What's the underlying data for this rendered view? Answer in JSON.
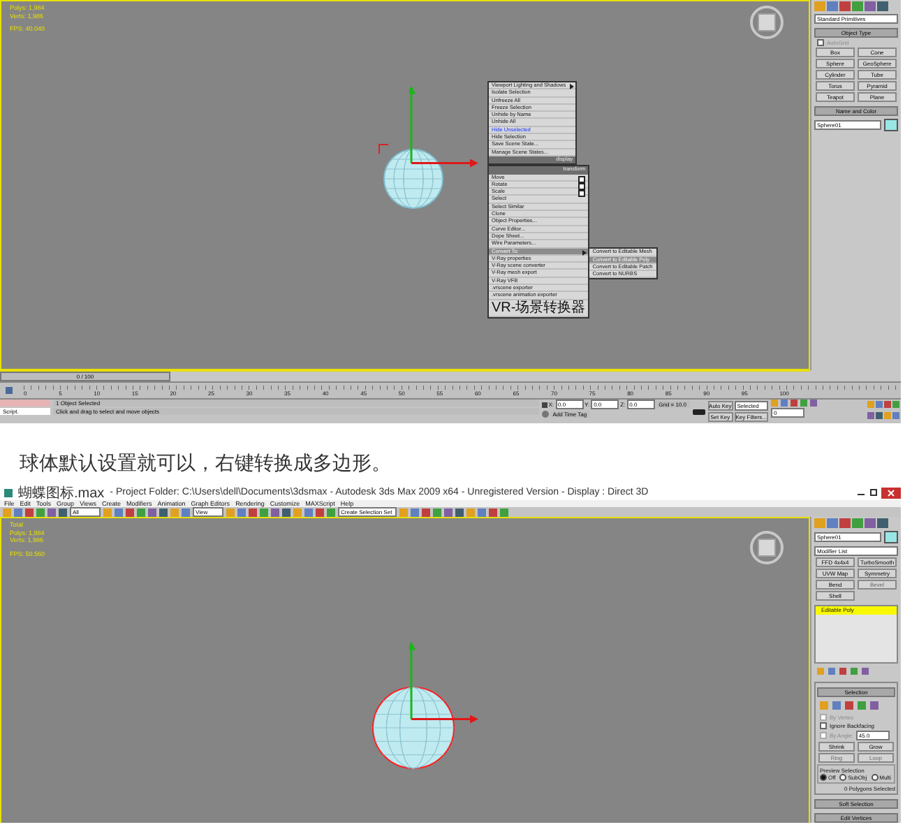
{
  "screenshot_1": {
    "viewport": {
      "stats": [
        "Polys: 1,984",
        "Verts: 1,986",
        "FPS: 40.040"
      ]
    },
    "quad_menu": {
      "items": [
        {
          "kind": "item",
          "label": "Viewport Lighting and Shadows",
          "arrow": true,
          "options": false,
          "selected": false
        },
        {
          "kind": "item",
          "label": "Isolate Selection",
          "arrow": false,
          "options": false,
          "selected": false
        },
        {
          "kind": "item",
          "label": "Unfreeze All",
          "arrow": false,
          "options": false,
          "selected": false
        },
        {
          "kind": "item",
          "label": "Freeze Selection",
          "arrow": false,
          "options": false,
          "selected": false
        },
        {
          "kind": "item",
          "label": "Unhide by Name",
          "arrow": false,
          "options": false,
          "selected": false
        },
        {
          "kind": "item",
          "label": "Unhide All",
          "arrow": false,
          "options": false,
          "selected": false
        },
        {
          "kind": "link",
          "label": "Hide Unselected",
          "arrow": false,
          "options": false,
          "selected": false
        },
        {
          "kind": "item",
          "label": "Hide Selection",
          "arrow": false,
          "options": false,
          "selected": false
        },
        {
          "kind": "item",
          "label": "Save Scene State...",
          "arrow": false,
          "options": false,
          "selected": false
        },
        {
          "kind": "item",
          "label": "Manage Scene States...",
          "arrow": false,
          "options": false,
          "selected": false
        },
        {
          "kind": "header",
          "label": "display",
          "arrow": false,
          "options": false,
          "selected": false
        },
        {
          "kind": "header",
          "label": "transform",
          "arrow": false,
          "options": false,
          "selected": false
        },
        {
          "kind": "item",
          "label": "Move",
          "arrow": false,
          "options": true,
          "selected": false
        },
        {
          "kind": "item",
          "label": "Rotate",
          "arrow": false,
          "options": true,
          "selected": false
        },
        {
          "kind": "item",
          "label": "Scale",
          "arrow": false,
          "options": true,
          "selected": false
        },
        {
          "kind": "item",
          "label": "Select",
          "arrow": false,
          "options": false,
          "selected": false
        },
        {
          "kind": "item",
          "label": "Select Similar",
          "arrow": false,
          "options": false,
          "selected": false
        },
        {
          "kind": "item",
          "label": "Clone",
          "arrow": false,
          "options": false,
          "selected": false
        },
        {
          "kind": "item",
          "label": "Object Properties...",
          "arrow": false,
          "options": false,
          "selected": false
        },
        {
          "kind": "item",
          "label": "Curve Editor...",
          "arrow": false,
          "options": false,
          "selected": false
        },
        {
          "kind": "item",
          "label": "Dope Sheet...",
          "arrow": false,
          "options": false,
          "selected": false
        },
        {
          "kind": "item",
          "label": "Wire Parameters...",
          "arrow": false,
          "options": false,
          "selected": false
        },
        {
          "kind": "item",
          "label": "Convert To:",
          "arrow": true,
          "options": false,
          "selected": true
        },
        {
          "kind": "item",
          "label": "V-Ray properties",
          "arrow": false,
          "options": false,
          "selected": false
        },
        {
          "kind": "item",
          "label": "V-Ray scene converter",
          "arrow": false,
          "options": false,
          "selected": false
        },
        {
          "kind": "item",
          "label": "V-Ray mesh export",
          "arrow": false,
          "options": false,
          "selected": false
        },
        {
          "kind": "item",
          "label": "V-Ray VFB",
          "arrow": false,
          "options": false,
          "selected": false
        },
        {
          "kind": "item",
          "label": ".vrscene exporter",
          "arrow": false,
          "options": false,
          "selected": false
        },
        {
          "kind": "item",
          "label": ".vrscene animation exporter",
          "arrow": false,
          "options": false,
          "selected": false
        },
        {
          "kind": "item",
          "label": "VR-场景转换器",
          "arrow": false,
          "options": false,
          "selected": false
        }
      ],
      "submenu": [
        {
          "label": "Convert to Editable Mesh",
          "selected": false
        },
        {
          "label": "Convert to Editable Poly",
          "selected": true
        },
        {
          "label": "Convert to Editable Patch",
          "selected": false
        },
        {
          "label": "Convert to NURBS",
          "selected": false
        }
      ]
    },
    "command_panel": {
      "dropdown": "Standard Primitives",
      "object_type": "Object Type",
      "autogrid": {
        "label": "AutoGrid",
        "checked": false
      },
      "buttons": [
        "Box",
        "Cone",
        "Sphere",
        "GeoSphere",
        "Cylinder",
        "Tube",
        "Torus",
        "Pyramid",
        "Teapot",
        "Plane"
      ],
      "name_and_color": "Name and Color",
      "name": "Sphere01",
      "color": "#99e6e6"
    },
    "timeline": {
      "position": "0 / 100",
      "ticks": [
        "0",
        "5",
        "10",
        "15",
        "20",
        "25",
        "30",
        "35",
        "40",
        "45",
        "50",
        "55",
        "60",
        "65",
        "70",
        "75",
        "80",
        "85",
        "90",
        "95",
        "100"
      ]
    },
    "status": {
      "script": "Script.",
      "selection": "1 Object Selected",
      "prompt": "Click and drag to select and move objects",
      "coords": [
        {
          "label": "X:",
          "value": "0.0"
        },
        {
          "label": "Y:",
          "value": "0.0"
        },
        {
          "label": "Z:",
          "value": "0.0"
        }
      ],
      "grid": "Grid = 10.0",
      "time_tag": "Add Time Tag",
      "auto_key": "Auto Key",
      "key_mode": "Selected",
      "set_key": "Set Key",
      "key_filters": "Key Filters...",
      "frame": "0"
    }
  },
  "caption": "球体默认设置就可以，右键转换成多边形。",
  "screenshot_2": {
    "title_file": "蝴蝶图标.max",
    "title_rest": "- Project Folder: C:\\Users\\dell\\Documents\\3dsmax    - Autodesk 3ds Max  2009 x64  - Unregistered Version    - Display : Direct 3D",
    "menu": [
      "File",
      "Edit",
      "Tools",
      "Group",
      "Views",
      "Create",
      "Modifiers",
      "Animation",
      "Graph Editors",
      "Rendering",
      "Customize",
      "MAXScript",
      "Help"
    ],
    "toolbar": {
      "filter": "All",
      "coord": "View",
      "selection_set": "Create Selection Set"
    },
    "viewport": {
      "stats": [
        "Total",
        "Polys: 1,984",
        "Verts: 1,986",
        "FPS: 50.560"
      ]
    },
    "command_panel": {
      "name": "Sphere01",
      "color": "#99e6e6",
      "modifier_list": "Modifier List",
      "buttons": [
        {
          "label": "FFD 4x4x4",
          "disabled": false
        },
        {
          "label": "TurboSmooth",
          "disabled": false
        },
        {
          "label": "UVW Map",
          "disabled": false
        },
        {
          "label": "Symmetry",
          "disabled": false
        },
        {
          "label": "Bend",
          "disabled": false
        },
        {
          "label": "Bevel",
          "disabled": true
        },
        {
          "label": "Shell",
          "disabled": false
        }
      ],
      "stack": [
        {
          "label": "Editable Poly",
          "selected": true
        }
      ],
      "selection": {
        "title": "Selection",
        "options": [
          {
            "label": "By Vertex",
            "checked": false,
            "disabled": true
          },
          {
            "label": "Ignore Backfacing",
            "checked": false,
            "disabled": false
          },
          {
            "label": "By Angle:",
            "checked": false,
            "disabled": true
          }
        ],
        "angle": "45.0",
        "shrink": "Shrink",
        "grow": "Grow",
        "ring": "Ring",
        "loop": "Loop",
        "preview": "Preview Selection",
        "preview_modes": [
          {
            "label": "Off",
            "selected": true
          },
          {
            "label": "SubObj",
            "selected": false
          },
          {
            "label": "Multi",
            "selected": false
          }
        ],
        "count": "0 Polygons Selected"
      },
      "rollouts": [
        "Soft Selection",
        "Edit Vertices"
      ]
    }
  }
}
